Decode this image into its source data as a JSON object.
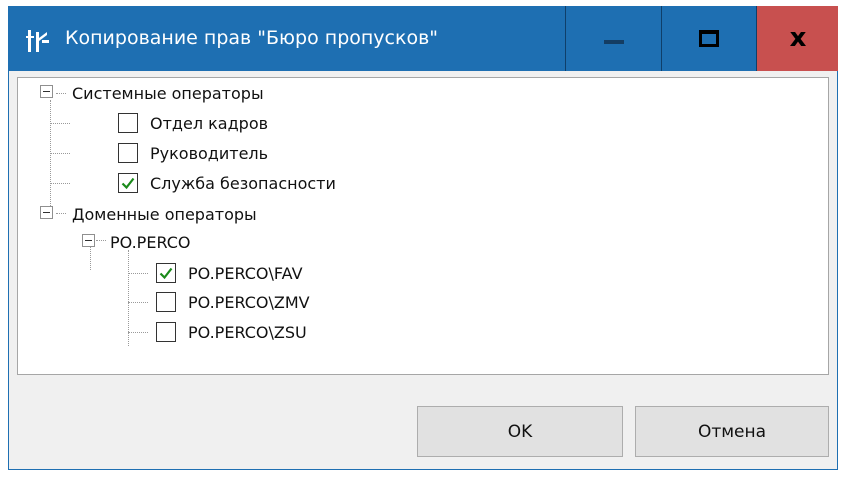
{
  "window": {
    "title": "Копирование прав \"Бюро пропусков\""
  },
  "tree": {
    "groups": [
      {
        "label": "Системные операторы",
        "items": [
          {
            "label": "Отдел кадров",
            "checked": false
          },
          {
            "label": "Руководитель",
            "checked": false
          },
          {
            "label": "Служба безопасности",
            "checked": true
          }
        ]
      },
      {
        "label": "Доменные операторы",
        "subgroup": {
          "label": "PO.PERCO",
          "items": [
            {
              "label": "PO.PERCO\\FAV",
              "checked": true
            },
            {
              "label": "PO.PERCO\\ZMV",
              "checked": false
            },
            {
              "label": "PO.PERCO\\ZSU",
              "checked": false
            }
          ]
        }
      }
    ]
  },
  "buttons": {
    "ok": "OK",
    "cancel": "Отмена"
  },
  "colors": {
    "titlebar": "#1e6fb2",
    "close": "#c8504f",
    "check": "#1a8a1a"
  }
}
